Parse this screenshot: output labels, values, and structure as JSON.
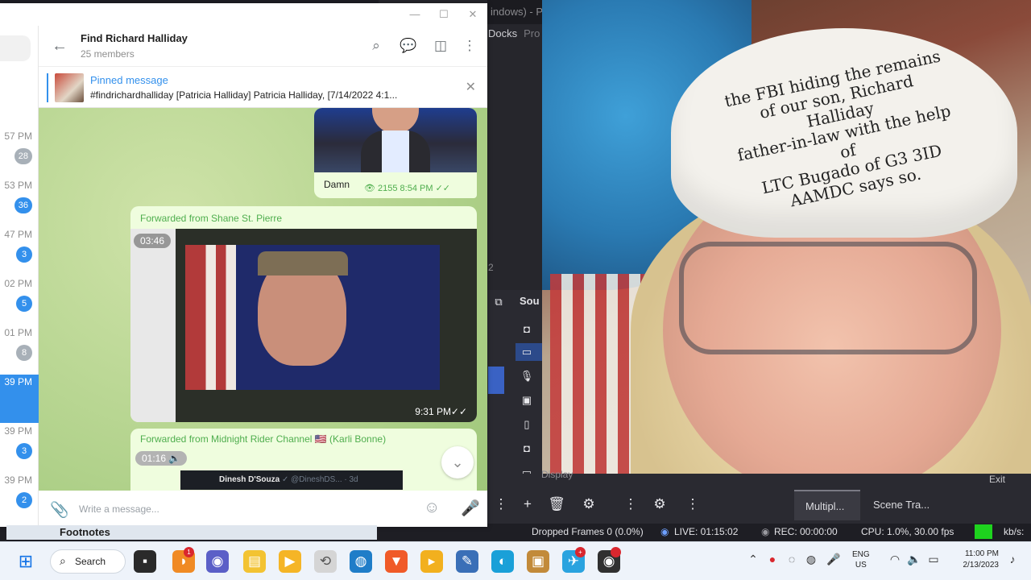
{
  "telegram": {
    "chat_title": "Find Richard Halliday",
    "chat_subtitle": "25 members",
    "pinned_label": "Pinned message",
    "pinned_text": "#findrichardhalliday [Patricia Halliday] Patricia Halliday, [7/14/2022 4:1...",
    "composer_placeholder": "Write a message...",
    "sidebar": [
      {
        "time": "57 PM",
        "badge": "28",
        "badge_color": "#a8b0b8"
      },
      {
        "time": "53 PM",
        "badge": "36",
        "badge_color": "#3390ec"
      },
      {
        "time": "47 PM",
        "badge": "3",
        "badge_color": "#3390ec"
      },
      {
        "time": "02 PM",
        "badge": "5",
        "badge_color": "#3390ec"
      },
      {
        "time": "01 PM",
        "badge": "8",
        "badge_color": "#a8b0b8"
      },
      {
        "time": "39 PM",
        "badge": "",
        "badge_color": "#3390ec",
        "active": true
      },
      {
        "time": "39 PM",
        "badge": "3",
        "badge_color": "#3390ec"
      },
      {
        "time": "39 PM",
        "badge": "2",
        "badge_color": "#3390ec"
      }
    ],
    "messages": {
      "msg1_caption": "Damn",
      "msg1_meta": "👁 2155  8:54 PM  ✓✓",
      "msg2_forward": "Forwarded from Shane St. Pierre",
      "msg2_duration": "03:46",
      "msg2_time": "9:31 PM",
      "msg2_tick": "✓✓",
      "msg3_forward": "Forwarded from Midnight Rider Channel 🇺🇸 (Karli Bonne)",
      "msg3_duration": "01:16 🔈",
      "msg3_tweet_name": "Dinesh D'Souza",
      "msg3_tweet_handle": " ✓ @DineshDS... · 3d"
    },
    "footnotes": "Footnotes"
  },
  "obs": {
    "window_title": "indows) - Pro",
    "docks_label": "Docks",
    "profile_label": "Pro",
    "sources_header": "Sou",
    "display_label": "Display",
    "tabs": {
      "multi": "Multipl...",
      "scene": "Scene Tra..."
    },
    "exit_label": "Exit",
    "status": {
      "dropped": "Dropped Frames 0 (0.0%)",
      "live": "LIVE: 01:15:02",
      "rec": "REC: 00:00:00",
      "cpu": "CPU: 1.0%, 30.00 fps",
      "kbs": "kb/s:"
    },
    "number_2": "2"
  },
  "webcam": {
    "hat_text": "the FBI hiding the remains\nof our son, Richard Halliday\nfather-in-law with the help of\nLTC Bugado of G3 3ID\nAAMDC says so."
  },
  "taskbar": {
    "search_label": "Search",
    "lang": "ENG",
    "region": "US",
    "time": "11:00 PM",
    "date": "2/13/2023"
  }
}
